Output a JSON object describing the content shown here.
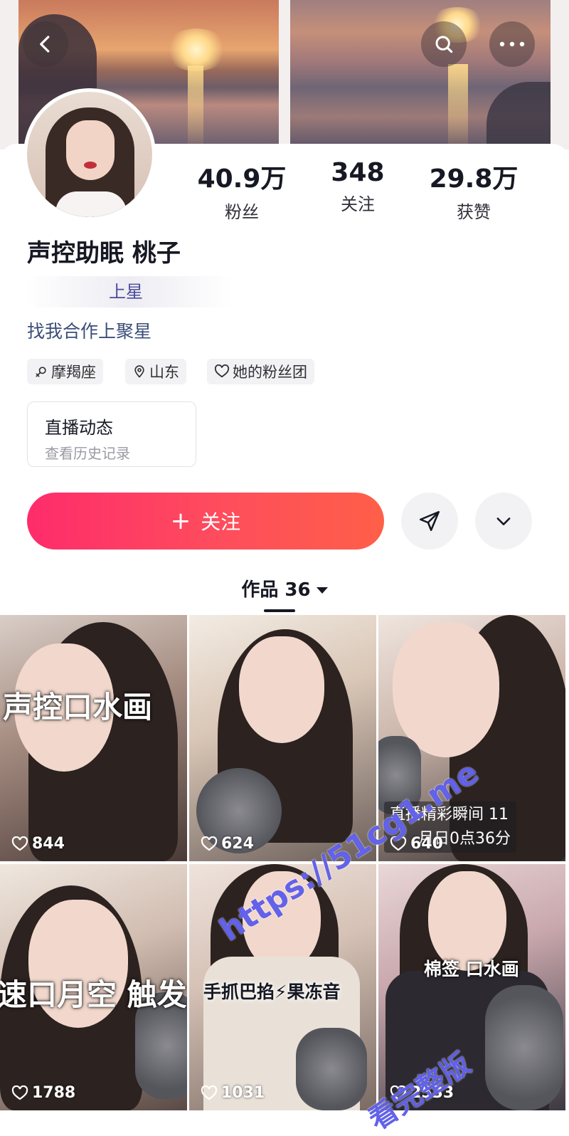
{
  "header": {
    "back_icon": "chevron-left-icon",
    "search_icon": "search-icon",
    "more_icon": "more-horizontal-icon"
  },
  "profile": {
    "nickname": "声控助眠 桃子",
    "partial_text": "上星",
    "cooperation_link": "找我合作上聚星",
    "stats": [
      {
        "value": "40.9万",
        "label": "粉丝"
      },
      {
        "value": "348",
        "label": "关注"
      },
      {
        "value": "29.8万",
        "label": "获赞"
      }
    ],
    "tags": [
      {
        "icon": "female-icon",
        "label": "摩羯座"
      },
      {
        "icon": "location-pin-icon",
        "label": "山东"
      },
      {
        "icon": "heart-outline-icon",
        "label": "她的粉丝团"
      }
    ],
    "live_box": {
      "title": "直播动态",
      "subtitle": "查看历史记录"
    }
  },
  "actions": {
    "follow_plus": "+",
    "follow_label": "关注",
    "share_icon": "send-icon",
    "expand_icon": "chevron-down-icon"
  },
  "works_tab": {
    "label": "作品 36"
  },
  "videos": [
    {
      "overlay": "声控口水画",
      "likes": "844"
    },
    {
      "overlay": "",
      "likes": "624"
    },
    {
      "overlay": "直播精彩瞬间 11",
      "overlay2": "月日0点36分",
      "likes": "640"
    },
    {
      "overlay": "速口月空 触发",
      "likes": "1788"
    },
    {
      "overlay": "手抓巴掐⚡果冻音",
      "likes": "1031"
    },
    {
      "overlay": "棉签 口水画",
      "likes": "2533"
    }
  ],
  "watermark": {
    "line1": "https://51cg1.me",
    "line2": "看完整版"
  },
  "colors": {
    "accent": "#fe2c55",
    "link": "#3b4e78"
  }
}
